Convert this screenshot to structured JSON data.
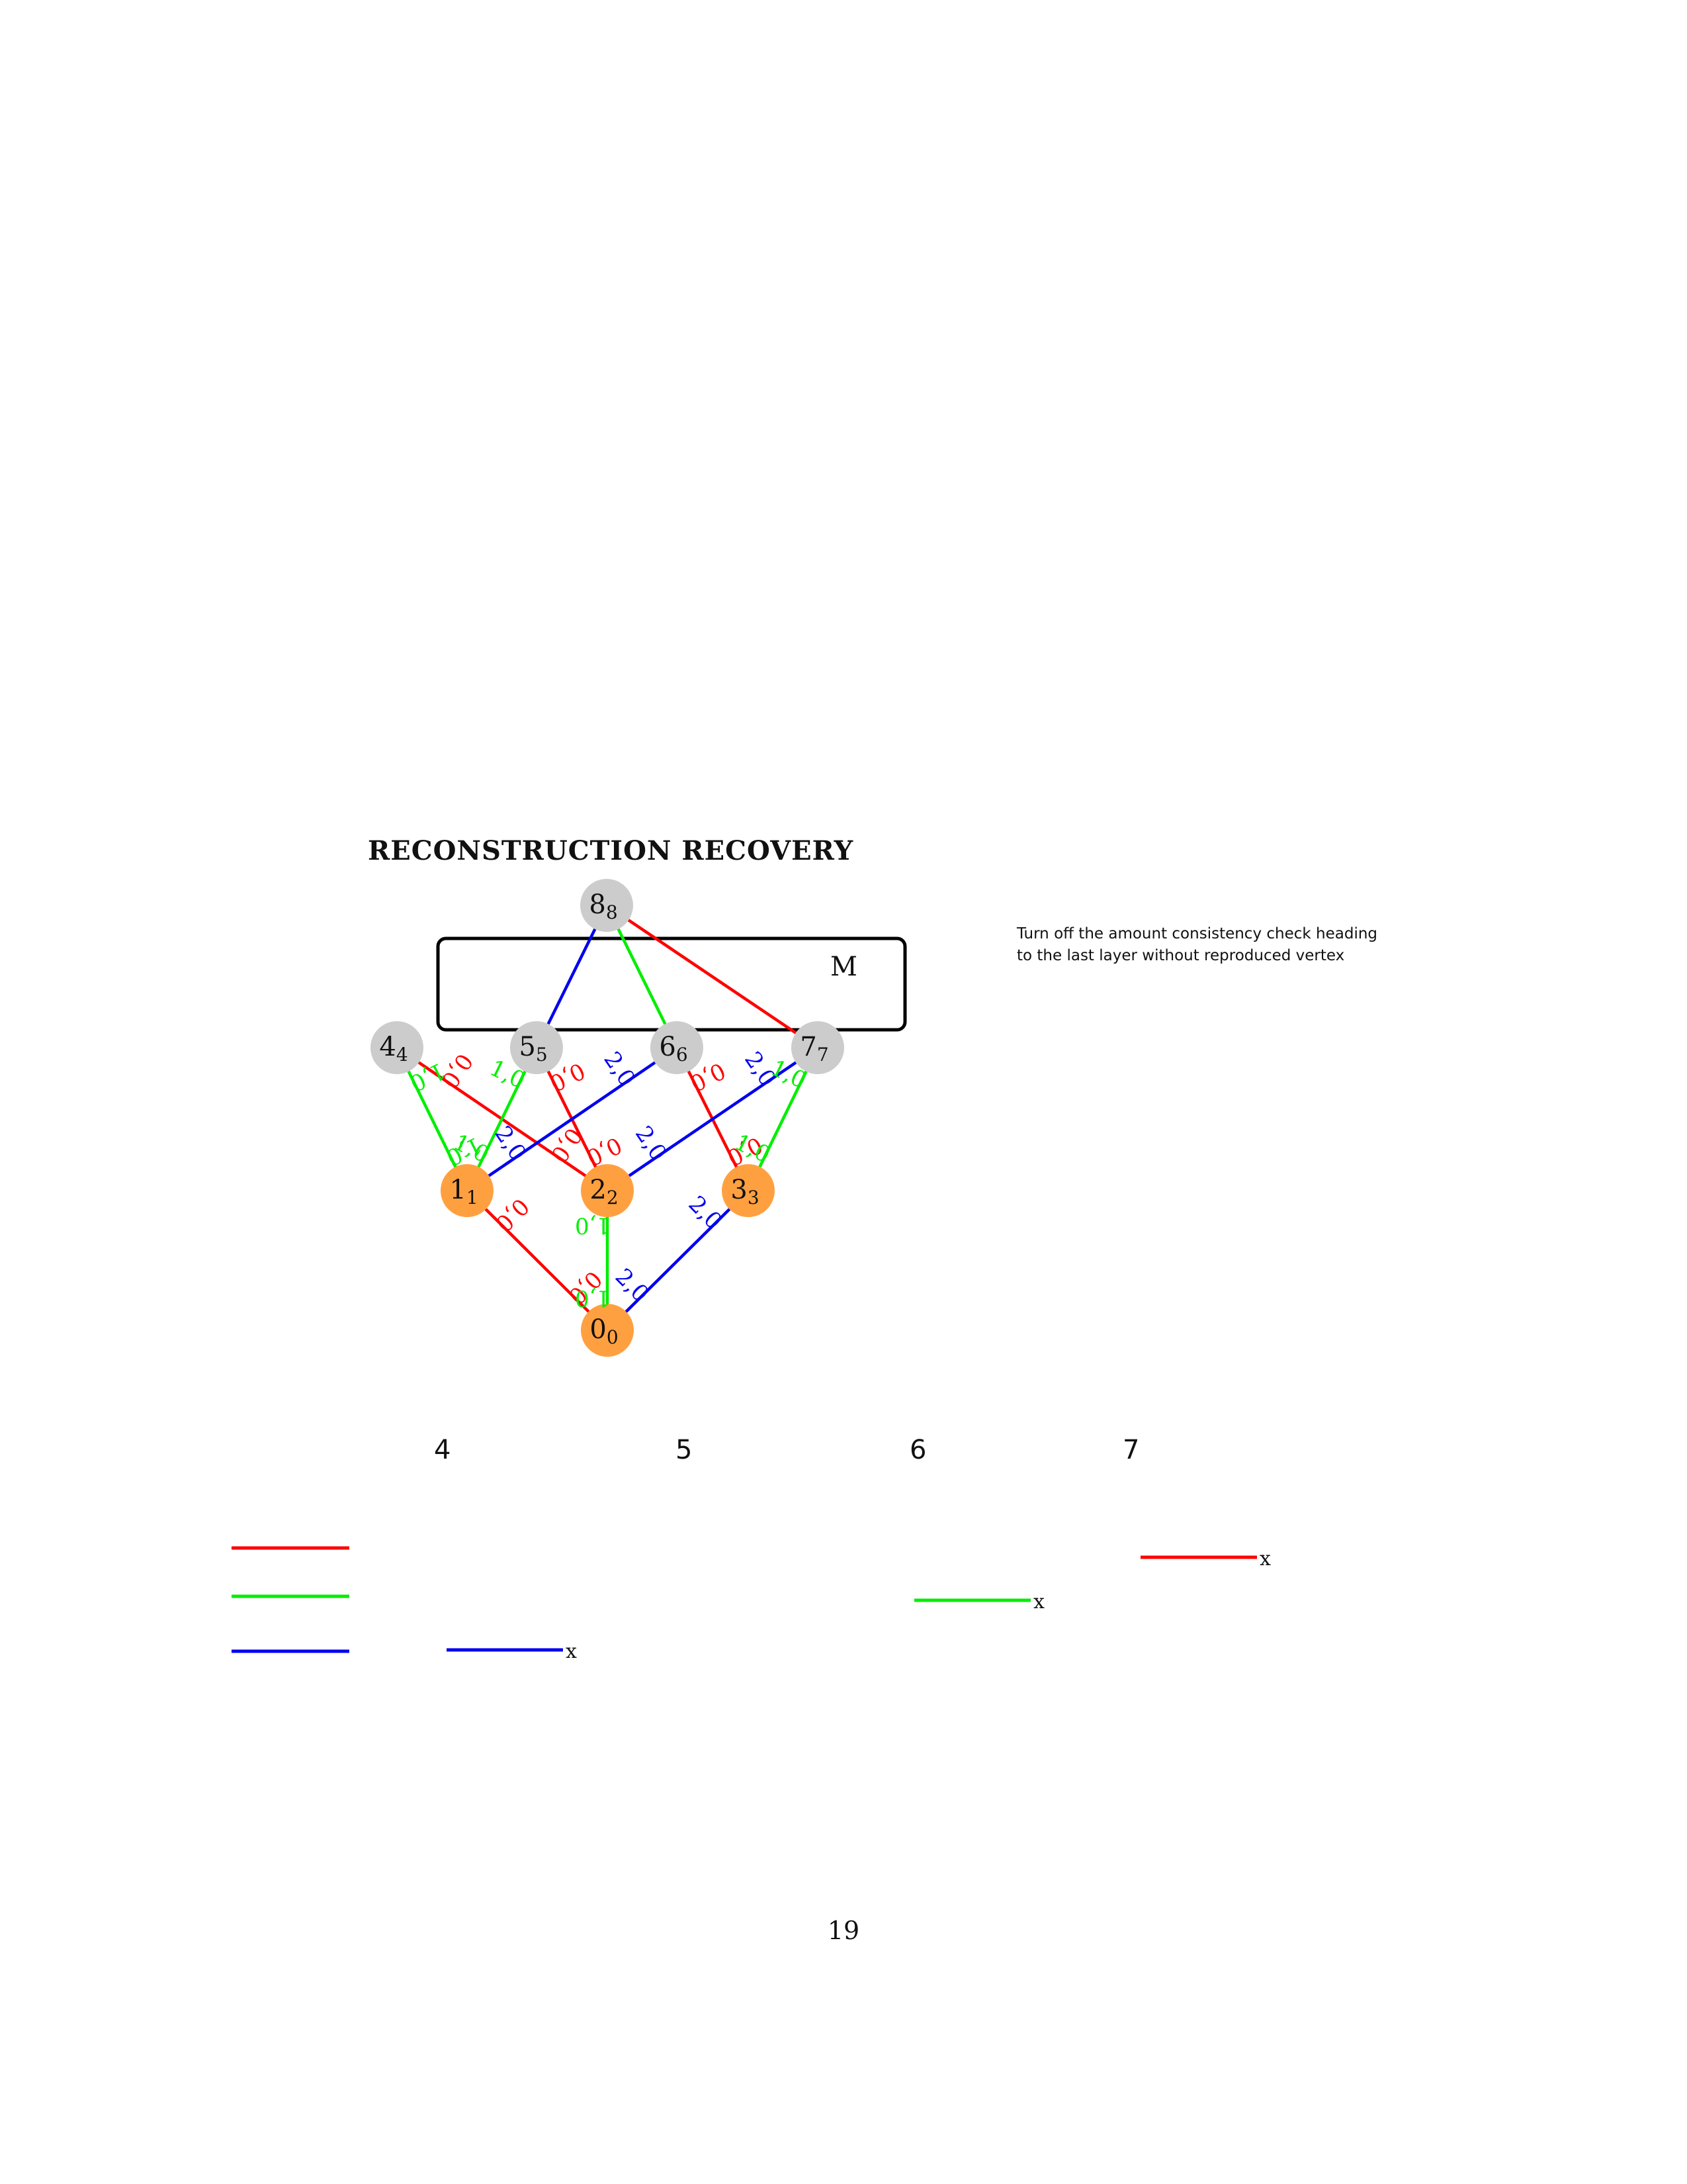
{
  "heading": "RECONSTRUCTION RECOVERY",
  "note": "Turn off the amount consistency check heading to the last layer without reproduced vertex",
  "box_label": "M",
  "page_number": "19",
  "colors": {
    "red": "#ff0000",
    "green": "#00ee00",
    "blue": "#0000ee",
    "orange": "#ffa040",
    "gray": "#cccccc",
    "black": "#000000"
  },
  "nodes": [
    {
      "id": "8",
      "main": "8",
      "sub": "8",
      "fill": "gray"
    },
    {
      "id": "4",
      "main": "4",
      "sub": "4",
      "fill": "gray"
    },
    {
      "id": "5",
      "main": "5",
      "sub": "5",
      "fill": "gray"
    },
    {
      "id": "6",
      "main": "6",
      "sub": "6",
      "fill": "gray"
    },
    {
      "id": "7",
      "main": "7",
      "sub": "7",
      "fill": "gray"
    },
    {
      "id": "1",
      "main": "1",
      "sub": "1",
      "fill": "orange"
    },
    {
      "id": "2",
      "main": "2",
      "sub": "2",
      "fill": "orange"
    },
    {
      "id": "3",
      "main": "3",
      "sub": "3",
      "fill": "orange"
    },
    {
      "id": "0",
      "main": "0",
      "sub": "0",
      "fill": "orange"
    }
  ],
  "edges": [
    {
      "from": "8",
      "to": "5",
      "color": "blue"
    },
    {
      "from": "8",
      "to": "6",
      "color": "green"
    },
    {
      "from": "8",
      "to": "7",
      "color": "red"
    },
    {
      "from": "4",
      "to": "1",
      "color": "green",
      "labels": [
        "1,0",
        "1,0"
      ]
    },
    {
      "from": "4",
      "to": "2",
      "color": "red",
      "labels": [
        "0,0",
        "0,0"
      ]
    },
    {
      "from": "5",
      "to": "1",
      "color": "green",
      "labels": [
        "1,0",
        "1,0"
      ]
    },
    {
      "from": "5",
      "to": "2",
      "color": "red",
      "labels": [
        "0,0",
        "0,0"
      ]
    },
    {
      "from": "6",
      "to": "1",
      "color": "blue",
      "labels": [
        "2,0",
        "2,0"
      ]
    },
    {
      "from": "6",
      "to": "3",
      "color": "red",
      "labels": [
        "0,0",
        "0,0"
      ]
    },
    {
      "from": "7",
      "to": "2",
      "color": "blue",
      "labels": [
        "2,0",
        "2,0"
      ]
    },
    {
      "from": "7",
      "to": "3",
      "color": "green",
      "labels": [
        "1,0",
        "1,0"
      ]
    },
    {
      "from": "1",
      "to": "0",
      "color": "red",
      "labels": [
        "0,0",
        "0,0"
      ]
    },
    {
      "from": "2",
      "to": "0",
      "color": "green",
      "labels": [
        "1,0",
        "1,0"
      ]
    },
    {
      "from": "3",
      "to": "0",
      "color": "blue",
      "labels": [
        "2,0",
        "2,0"
      ]
    }
  ],
  "columns": [
    "4",
    "5",
    "6",
    "7"
  ],
  "legend_lines": [
    "red",
    "green",
    "blue"
  ],
  "marks": [
    {
      "column": "4",
      "color": "blue",
      "text": "x"
    },
    {
      "column": "6",
      "color": "green",
      "text": "x"
    },
    {
      "column": "7",
      "color": "red",
      "text": "x"
    }
  ]
}
